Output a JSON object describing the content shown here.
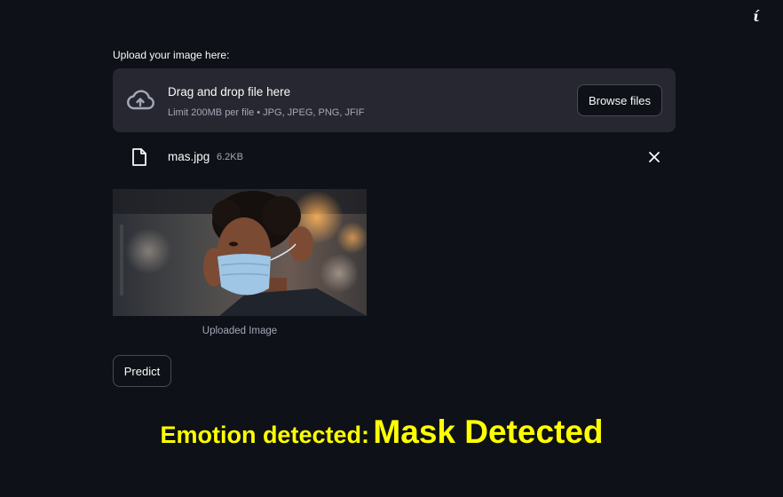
{
  "header": {
    "menu_icon": "info-icon"
  },
  "uploader": {
    "label": "Upload your image here:",
    "drag_text": "Drag and drop file here",
    "limit_text": "Limit 200MB per file • JPG, JPEG, PNG, JFIF",
    "browse_label": "Browse files",
    "upload_icon": "cloud-upload-icon"
  },
  "file": {
    "name": "mas.jpg",
    "size": "6.2KB",
    "file_icon": "file-icon",
    "remove_icon": "close-icon"
  },
  "image": {
    "caption": "Uploaded Image"
  },
  "actions": {
    "predict_label": "Predict"
  },
  "result": {
    "prefix": "Emotion detected:",
    "value": "Mask Detected",
    "color": "#ffff00"
  },
  "theme": {
    "background": "#0e1117",
    "surface": "#262730",
    "text": "#fafafa",
    "muted": "#a3a8b8"
  }
}
